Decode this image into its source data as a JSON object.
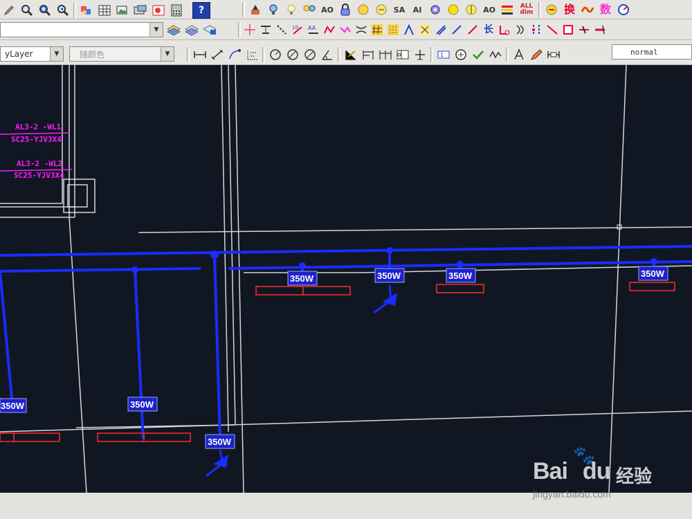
{
  "toolbar_row1": {
    "icons_left": [
      "pencil-icon",
      "zoom-icon",
      "zoom-window-icon",
      "zoom-previous-icon",
      "paint-icon",
      "table-icon",
      "picture-icon",
      "layer-icon",
      "calculator-icon",
      "help-icon"
    ],
    "help_label": "?",
    "icons_right": [
      "north-arrow-icon",
      "bulb-icon",
      "bulb-outline-icon",
      "bulb-pair-icon",
      "ao-text-icon",
      "lock-icon",
      "ai-text-icon",
      "ao-text2-icon",
      "ss-text-icon",
      "ai-text2-icon",
      "gear-icon",
      "yellow-circle-icon",
      "ai-text3-icon",
      "ao-text3-icon",
      "stack-icon",
      "all-dim-icon"
    ],
    "ao_label": "AO",
    "ss_label": "SA",
    "ai_label": "AI",
    "all_label": "ALL dim",
    "chinese_label_1": "换",
    "chinese_label_2": "数"
  },
  "toolbar_row2": {
    "combo_value": "",
    "labels": {
      "chang": "长"
    }
  },
  "toolbar_row3": {
    "layer_combo": "yLayer",
    "color_combo": "随颜色",
    "style_combo": "normal"
  },
  "drawing": {
    "annotations": [
      {
        "text": "AL3-2 -WL1"
      },
      {
        "text": "SC25-YJV3X4"
      },
      {
        "text": "AL3-2 -WL2"
      },
      {
        "text": "SC25-YJV3X4"
      }
    ],
    "lamp_labels": [
      "350W",
      "350W",
      "350W",
      "350W",
      "350W",
      "350W",
      "350W"
    ],
    "colors": {
      "background": "#111722",
      "wire": "#1a2cff",
      "frame": "#d8d8d8",
      "annotation": "#ff1aff",
      "fixture": "#ff2a2a",
      "label_bg": "#1c23c9"
    }
  },
  "watermark": {
    "logo": "Bai",
    "logo_tail": "du",
    "text": "经验",
    "url": "jingyan.baidu.com"
  }
}
